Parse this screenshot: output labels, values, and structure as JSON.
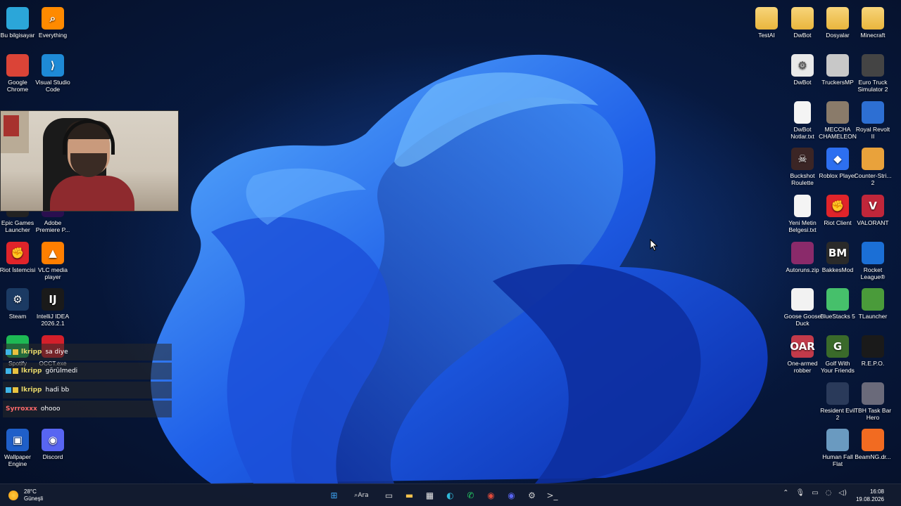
{
  "desktop": {
    "left_icons": [
      {
        "label": "Bu bilgisayar",
        "icon": "monitor-icon",
        "glyph": "",
        "color": "#2ba6d9"
      },
      {
        "label": "Everything",
        "icon": "magnifier-icon",
        "glyph": "⌕",
        "color": "#ff8a00"
      },
      {
        "label": "Google Chrome",
        "icon": "chrome-icon",
        "glyph": "",
        "color": "#db4437"
      },
      {
        "label": "Visual Studio Code",
        "icon": "vscode-icon",
        "glyph": "⟩",
        "color": "#1e8ad6"
      },
      {
        "label": "Epic Games Launcher",
        "icon": "epic-icon",
        "glyph": "",
        "color": "#222222"
      },
      {
        "label": "Adobe Premiere P...",
        "icon": "premiere-icon",
        "glyph": "",
        "color": "#2a0f4f"
      },
      {
        "label": "Riot İstemcisi",
        "icon": "riot-icon",
        "glyph": "✊",
        "color": "#e0242a"
      },
      {
        "label": "VLC media player",
        "icon": "vlc-icon",
        "glyph": "▲",
        "color": "#ff7f00"
      },
      {
        "label": "Steam",
        "icon": "steam-icon",
        "glyph": "⚙",
        "color": "#1b3a63"
      },
      {
        "label": "IntelliJ IDEA 2026.2.1",
        "icon": "intellij-icon",
        "glyph": "IJ",
        "color": "#1a1a1a"
      },
      {
        "label": "Spotify",
        "icon": "spotify-icon",
        "glyph": "",
        "color": "#1db954"
      },
      {
        "label": "OCCT.exe",
        "icon": "occt-icon",
        "glyph": "",
        "color": "#d31f2a"
      },
      {
        "label": "Wallpaper Engine",
        "icon": "wallpaper-engine-icon",
        "glyph": "▣",
        "color": "#1f5fc9"
      },
      {
        "label": "Discord",
        "icon": "discord-icon",
        "glyph": "◉",
        "color": "#5865f2"
      }
    ],
    "right_icons": [
      {
        "label": "TestAI",
        "icon": "folder-icon",
        "glyph": "",
        "color": "#f0c24e"
      },
      {
        "label": "DwBot",
        "icon": "folder-icon",
        "glyph": "",
        "color": "#f0c24e"
      },
      {
        "label": "Dosyalar",
        "icon": "folder-icon",
        "glyph": "",
        "color": "#f0c24e"
      },
      {
        "label": "Minecraft",
        "icon": "folder-icon",
        "glyph": "",
        "color": "#f0c24e"
      },
      {
        "label": "DwBot",
        "icon": "settings-file-icon",
        "glyph": "⚙",
        "color": "#e9e9e9"
      },
      {
        "label": "TruckersMP",
        "icon": "truck-icon",
        "glyph": "",
        "color": "#c8c8c8"
      },
      {
        "label": "Euro Truck Simulator 2",
        "icon": "truck-icon",
        "glyph": "",
        "color": "#444444"
      },
      {
        "label": "DwBot Notlar.txt",
        "icon": "text-file-icon",
        "glyph": "",
        "color": "#f4f4f4"
      },
      {
        "label": "MECCHA CHAMELEON",
        "icon": "game-icon",
        "glyph": "",
        "color": "#8a7b6a"
      },
      {
        "label": "Royal Revolt II",
        "icon": "game-icon",
        "glyph": "",
        "color": "#2d6fd3"
      },
      {
        "label": "Buckshot Roulette",
        "icon": "skull-icon",
        "glyph": "☠",
        "color": "#3b2525"
      },
      {
        "label": "Roblox Player",
        "icon": "roblox-icon",
        "glyph": "◆",
        "color": "#2d6ff0"
      },
      {
        "label": "Counter-Stri... 2",
        "icon": "cs2-icon",
        "glyph": "",
        "color": "#e9a23b"
      },
      {
        "label": "Yeni Metin Belgesi.txt",
        "icon": "text-file-icon",
        "glyph": "",
        "color": "#f4f4f4"
      },
      {
        "label": "Riot Client",
        "icon": "riot-icon",
        "glyph": "✊",
        "color": "#e0242a"
      },
      {
        "label": "VALORANT",
        "icon": "valorant-icon",
        "glyph": "V",
        "color": "#c0263a"
      },
      {
        "label": "Autoruns.zip",
        "icon": "archive-icon",
        "glyph": "",
        "color": "#8a2a6a"
      },
      {
        "label": "BakkesMod",
        "icon": "bakkesmod-icon",
        "glyph": "BM",
        "color": "#2a2a2a"
      },
      {
        "label": "Rocket League®",
        "icon": "rocket-league-icon",
        "glyph": "",
        "color": "#1b6fd6"
      },
      {
        "label": "Goose Goose Duck",
        "icon": "goose-icon",
        "glyph": "",
        "color": "#f2f2f2"
      },
      {
        "label": "BlueStacks 5",
        "icon": "bluestacks-icon",
        "glyph": "",
        "color": "#46c06b"
      },
      {
        "label": "TLauncher",
        "icon": "tlauncher-icon",
        "glyph": "",
        "color": "#4a9b3a"
      },
      {
        "label": "One-armed robber",
        "icon": "slot-machine-icon",
        "glyph": "OAR",
        "color": "#c23a4a"
      },
      {
        "label": "Golf With Your Friends",
        "icon": "golf-icon",
        "glyph": "G",
        "color": "#3a6a2a"
      },
      {
        "label": "R.E.P.O.",
        "icon": "repo-icon",
        "glyph": "",
        "color": "#1a1a1a"
      },
      {
        "label": "Resident Evil 2",
        "icon": "resident-evil-icon",
        "glyph": "",
        "color": "#2a3a5a"
      },
      {
        "label": "TBH Task Bar Hero",
        "icon": "game-icon",
        "glyph": "",
        "color": "#6a6a7a"
      },
      {
        "label": "Human Fall Flat",
        "icon": "game-icon",
        "glyph": "",
        "color": "#6a9ac0"
      },
      {
        "label": "BeamNG.dr...",
        "icon": "beamng-icon",
        "glyph": "",
        "color": "#f26b21"
      }
    ]
  },
  "chat": [
    {
      "user": "lkripp",
      "message": "sa diye",
      "red": false
    },
    {
      "user": "lkripp",
      "message": "görülmedi",
      "red": false
    },
    {
      "user": "lkripp",
      "message": "hadi bb",
      "red": false
    },
    {
      "user": "Syrroxxx",
      "message": "ohooo",
      "red": true
    }
  ],
  "taskbar": {
    "weather_temp": "28°C",
    "weather_desc": "Güneşli",
    "search_label": "Ara",
    "time": "16:08",
    "date": "19.08.2026",
    "apps": [
      {
        "name": "start-button",
        "glyph": "⊞",
        "color": "#3da5f4"
      },
      {
        "name": "search-button",
        "glyph": "",
        "color": "#dddddd"
      },
      {
        "name": "task-view-button",
        "glyph": "▭",
        "color": "#dddddd"
      },
      {
        "name": "file-explorer-button",
        "glyph": "▬",
        "color": "#f2c14e"
      },
      {
        "name": "store-button",
        "glyph": "▦",
        "color": "#e8e8e8"
      },
      {
        "name": "edge-button",
        "glyph": "◐",
        "color": "#2fb8d8"
      },
      {
        "name": "whatsapp-button",
        "glyph": "✆",
        "color": "#25d366"
      },
      {
        "name": "chrome-button",
        "glyph": "◉",
        "color": "#e24b3b"
      },
      {
        "name": "discord-button",
        "glyph": "◉",
        "color": "#5865f2"
      },
      {
        "name": "steam-button",
        "glyph": "⚙",
        "color": "#cccccc"
      },
      {
        "name": "terminal-button",
        "glyph": ">_",
        "color": "#cccccc"
      }
    ]
  }
}
